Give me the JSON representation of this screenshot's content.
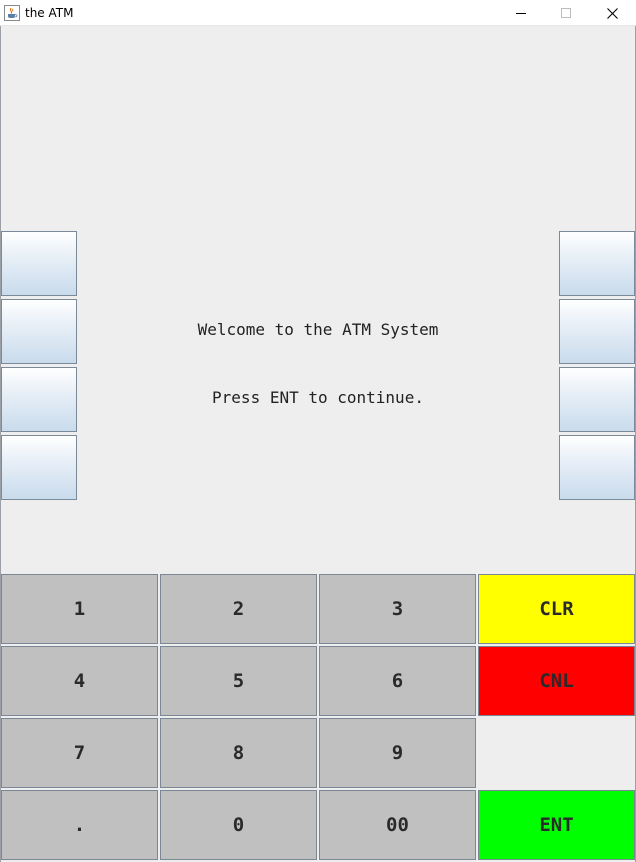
{
  "window": {
    "title": "the ATM",
    "icon": "java-cup-icon",
    "controls": [
      "minimize-icon",
      "maximize-icon",
      "close-icon"
    ]
  },
  "screen": {
    "line1": "Welcome to the ATM System",
    "line2": "Press ENT to continue."
  },
  "side_buttons": {
    "left": [
      "",
      "",
      "",
      ""
    ],
    "right": [
      "",
      "",
      "",
      ""
    ]
  },
  "keypad": {
    "k1": "1",
    "k2": "2",
    "k3": "3",
    "k4": "4",
    "k5": "5",
    "k6": "6",
    "k7": "7",
    "k8": "8",
    "k9": "9",
    "dot": ".",
    "k0": "0",
    "k00": "00",
    "clr": "CLR",
    "cnl": "CNL",
    "ent": "ENT"
  },
  "colors": {
    "clr": "#ffff00",
    "cnl": "#ff0000",
    "ent": "#00ff00",
    "key": "#c0c0c0"
  }
}
